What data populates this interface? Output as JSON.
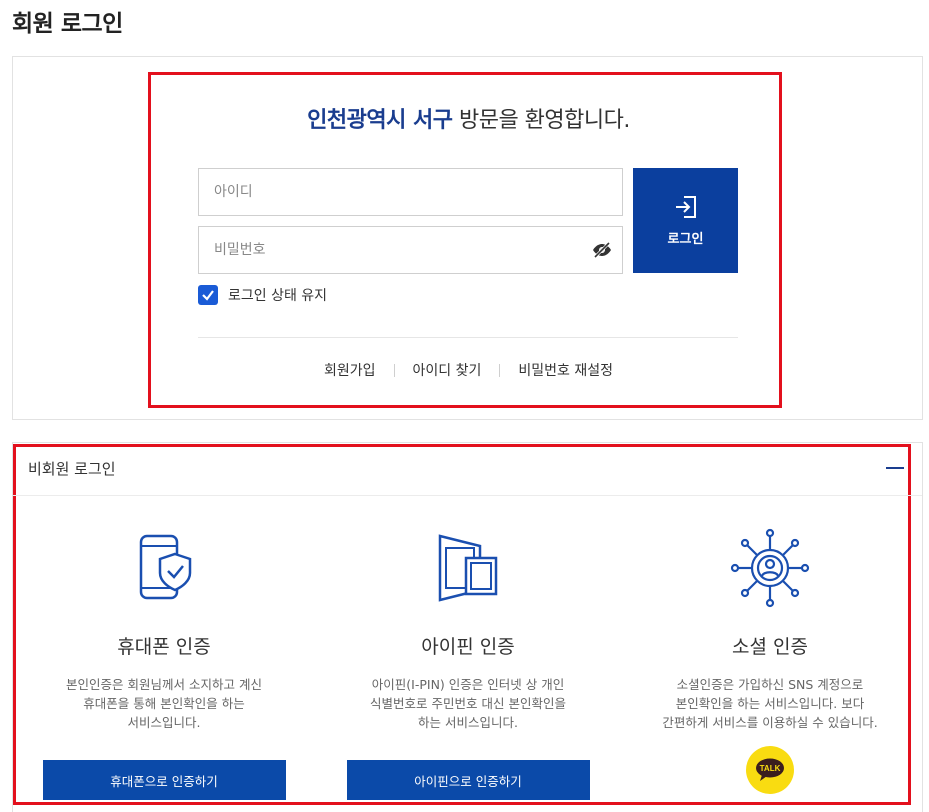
{
  "page": {
    "title": "회원 로그인"
  },
  "login": {
    "welcome_brand": "인천광역시 서구",
    "welcome_rest": " 방문을 환영합니다.",
    "id_placeholder": "아이디",
    "pw_placeholder": "비밀번호",
    "login_button": "로그인",
    "keep_login_label": "로그인 상태 유지",
    "keep_login_checked": true,
    "links": [
      "회원가입",
      "아이디 찾기",
      "비밀번호 재설정"
    ]
  },
  "guest": {
    "header": "비회원 로그인",
    "methods": [
      {
        "title": "휴대폰 인증",
        "icon": "smartphone-shield-icon",
        "desc_lines": [
          "본인인증은 회원님께서 소지하고 계신",
          "휴대폰을 통해 본인확인을 하는",
          "서비스입니다."
        ],
        "button": "휴대폰으로 인증하기"
      },
      {
        "title": "아이핀 인증",
        "icon": "ipin-cards-icon",
        "desc_lines": [
          "아이핀(I-PIN) 인증은 인터넷 상 개인",
          "식별번호로 주민번호 대신 본인확인을",
          "하는 서비스입니다."
        ],
        "button": "아이핀으로 인증하기"
      },
      {
        "title": "소셜 인증",
        "icon": "social-network-icon",
        "desc_lines": [
          "소셜인증은 가입하신 SNS 계정으로",
          "본인확인을 하는 서비스입니다. 보다",
          "간편하게 서비스를 이용하실 수 있습니다."
        ],
        "button_label": "TALK"
      }
    ]
  },
  "colors": {
    "primary": "#0b3f9e",
    "brand_text": "#1a3d8f",
    "highlight": "#e3101d",
    "kakao": "#f9dc11"
  }
}
